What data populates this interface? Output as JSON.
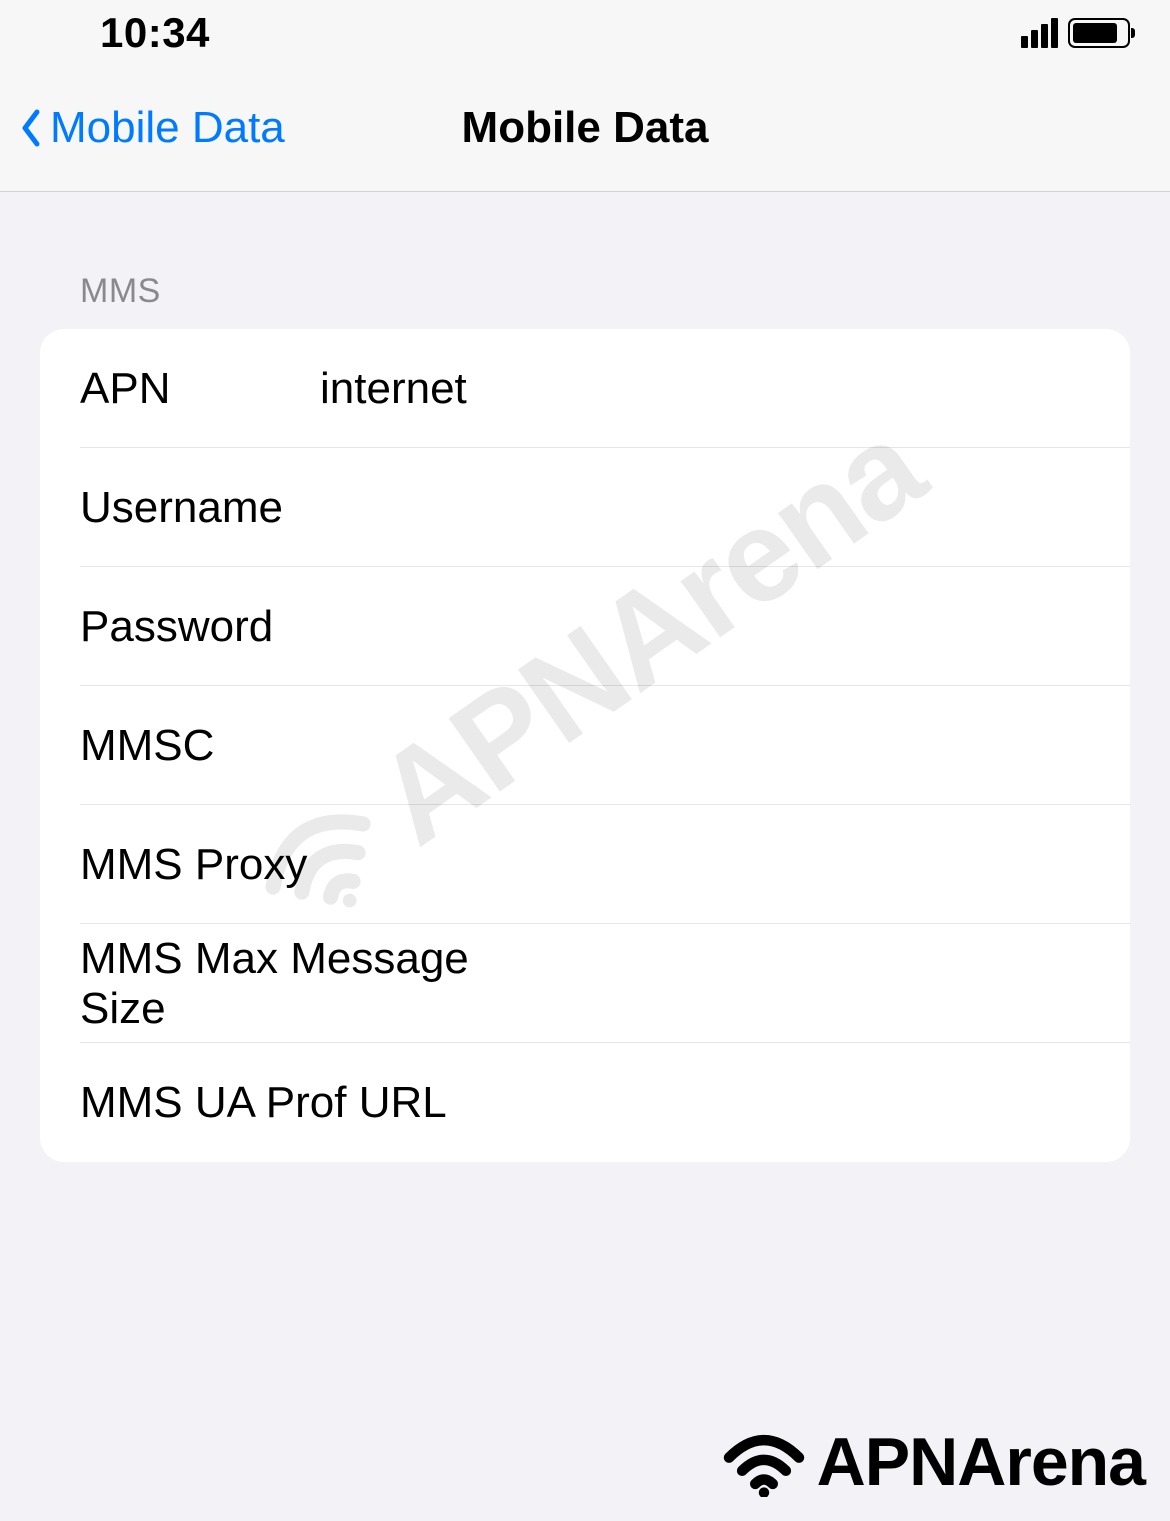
{
  "status": {
    "time": "10:34"
  },
  "nav": {
    "back_label": "Mobile Data",
    "title": "Mobile Data"
  },
  "section_header": "MMS",
  "fields": {
    "apn": {
      "label": "APN",
      "value": "internet"
    },
    "username": {
      "label": "Username",
      "value": ""
    },
    "password": {
      "label": "Password",
      "value": ""
    },
    "mmsc": {
      "label": "MMSC",
      "value": ""
    },
    "mms_proxy": {
      "label": "MMS Proxy",
      "value": ""
    },
    "mms_max_size": {
      "label": "MMS Max Message Size",
      "value": ""
    },
    "mms_ua_prof_url": {
      "label": "MMS UA Prof URL",
      "value": ""
    }
  },
  "watermark": "APNArena",
  "logo": "APNArena"
}
